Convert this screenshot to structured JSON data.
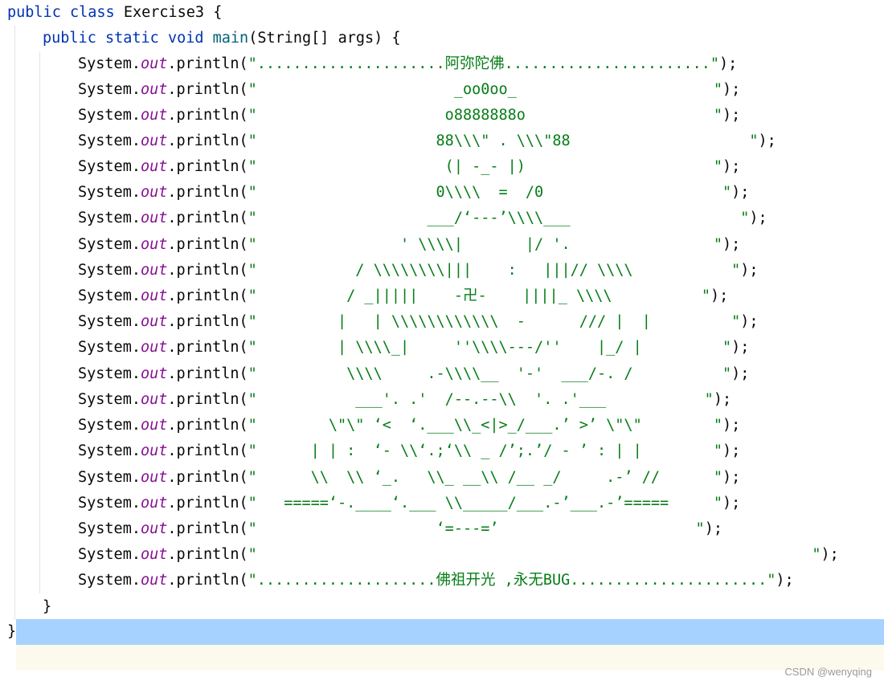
{
  "code": {
    "class_decl": {
      "kw_public": "public",
      "kw_class": "class",
      "name": "Exercise3",
      "brace": "{"
    },
    "main_decl": {
      "kw_public": "public",
      "kw_static": "static",
      "kw_void": "void",
      "method": "main",
      "params": "(String[] args) {"
    },
    "call_receiver": "System.",
    "call_field": "out",
    "call_method": ".println(",
    "call_end": ");",
    "print_lines": [
      "\".....................阿弥陀佛.......................\"",
      "\"                      _oo0oo_                      \"",
      "\"                     o8888888o                     \"",
      "\"                    88\\\\\\\" . \\\\\\\"88                    \"",
      "\"                     (| -_- |)                     \"",
      "\"                    0\\\\\\\\  =  /0                    \"",
      "\"                   ___/‘---’\\\\\\\\___                   \"",
      "\"                ' \\\\\\\\|       |/ '.                \"",
      "\"           / \\\\\\\\\\\\\\\\|||    :   |||// \\\\\\\\           \"",
      "\"          / _|||||    -卍-    ||||_ \\\\\\\\          \"",
      "\"         |   | \\\\\\\\\\\\\\\\\\\\\\\\  -      /// |  |         \"",
      "\"         | \\\\\\\\_|     ''\\\\\\\\---/''    |_/ |         \"",
      "\"          \\\\\\\\     .-\\\\\\\\__  '-'  ___/-. /          \"",
      "\"           ___'. .'  /--.--\\\\  '. .'___           \"",
      "\"        \\\"\\\" ‘<  ‘.___\\\\_<|>_/___.’ >’ \\\"\\\"        \"",
      "\"      | | :  ‘- \\\\‘.;‘\\\\ _ /’;.’/ - ’ : | |        \"",
      "\"      \\\\  \\\\ ‘_.   \\\\_ __\\\\ /__ _/     .-’ //      \"",
      "\"   =====‘-.____‘.___ \\\\_____/___.-’___.-’=====     \"",
      "\"                    ‘=---=’                      \"",
      "\"                                                              \"",
      "\"....................佛祖开光 ,永无BUG......................\""
    ],
    "close_method": "}",
    "close_class": "}"
  },
  "watermark": "CSDN @wenyqing",
  "colors": {
    "keyword": "#0033b3",
    "method": "#00627a",
    "field": "#871094",
    "string": "#067d17",
    "selection": "#a6d2ff"
  }
}
